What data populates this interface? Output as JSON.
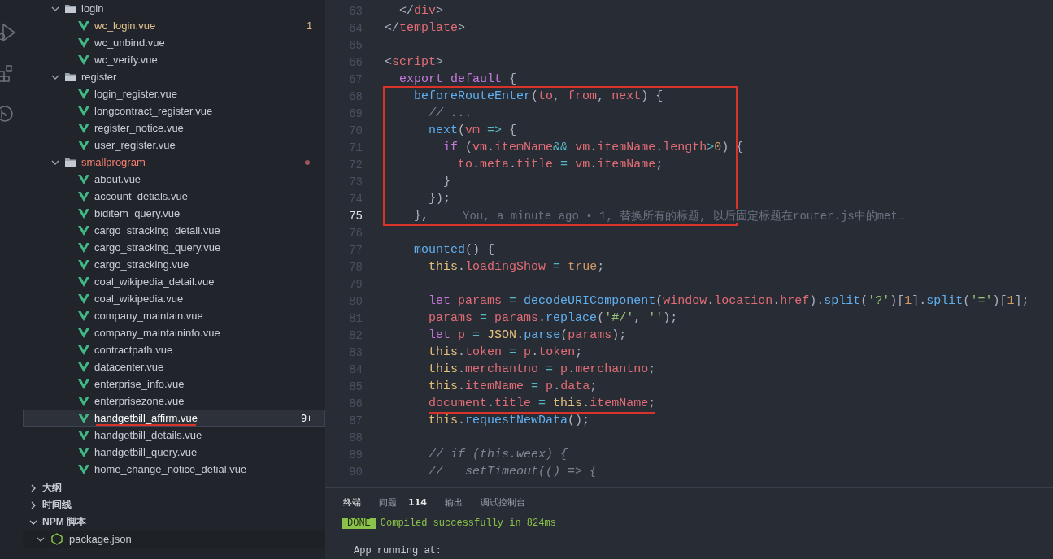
{
  "explorer": {
    "items": [
      {
        "label": "login",
        "kind": "folder",
        "expanded": true,
        "selected": false,
        "modified": false,
        "errors": false,
        "children": [
          {
            "label": "wc_login.vue",
            "kind": "file",
            "selected": false,
            "modified": true,
            "errors": false,
            "badge": "1"
          },
          {
            "label": "wc_unbind.vue",
            "kind": "file",
            "selected": false,
            "modified": false,
            "errors": false
          },
          {
            "label": "wc_verify.vue",
            "kind": "file",
            "selected": false,
            "modified": false,
            "errors": false
          }
        ]
      },
      {
        "label": "register",
        "kind": "folder",
        "expanded": true,
        "selected": false,
        "modified": false,
        "errors": false,
        "children": [
          {
            "label": "login_register.vue",
            "kind": "file",
            "selected": false,
            "modified": false,
            "errors": false
          },
          {
            "label": "longcontract_register.vue",
            "kind": "file",
            "selected": false,
            "modified": false,
            "errors": false
          },
          {
            "label": "register_notice.vue",
            "kind": "file",
            "selected": false,
            "modified": false,
            "errors": false
          },
          {
            "label": "user_register.vue",
            "kind": "file",
            "selected": false,
            "modified": false,
            "errors": false
          }
        ]
      },
      {
        "label": "smallprogram",
        "kind": "folder",
        "expanded": true,
        "selected": false,
        "modified": false,
        "errors": true,
        "children": [
          {
            "label": "about.vue",
            "kind": "file",
            "selected": false,
            "modified": false,
            "errors": false
          },
          {
            "label": "account_detials.vue",
            "kind": "file",
            "selected": false,
            "modified": false,
            "errors": false
          },
          {
            "label": "biditem_query.vue",
            "kind": "file",
            "selected": false,
            "modified": false,
            "errors": false
          },
          {
            "label": "cargo_stracking_detail.vue",
            "kind": "file",
            "selected": false,
            "modified": false,
            "errors": false
          },
          {
            "label": "cargo_stracking_query.vue",
            "kind": "file",
            "selected": false,
            "modified": false,
            "errors": false
          },
          {
            "label": "cargo_stracking.vue",
            "kind": "file",
            "selected": false,
            "modified": false,
            "errors": false
          },
          {
            "label": "coal_wikipedia_detail.vue",
            "kind": "file",
            "selected": false,
            "modified": false,
            "errors": false
          },
          {
            "label": "coal_wikipedia.vue",
            "kind": "file",
            "selected": false,
            "modified": false,
            "errors": false
          },
          {
            "label": "company_maintain.vue",
            "kind": "file",
            "selected": false,
            "modified": false,
            "errors": false
          },
          {
            "label": "company_maintaininfo.vue",
            "kind": "file",
            "selected": false,
            "modified": false,
            "errors": false
          },
          {
            "label": "contractpath.vue",
            "kind": "file",
            "selected": false,
            "modified": false,
            "errors": false
          },
          {
            "label": "datacenter.vue",
            "kind": "file",
            "selected": false,
            "modified": false,
            "errors": false
          },
          {
            "label": "enterprise_info.vue",
            "kind": "file",
            "selected": false,
            "modified": false,
            "errors": false
          },
          {
            "label": "enterprisezone.vue",
            "kind": "file",
            "selected": false,
            "modified": false,
            "errors": false
          },
          {
            "label": "handgetbill_affirm.vue",
            "kind": "file",
            "selected": true,
            "modified": false,
            "errors": false,
            "badge": "9+"
          },
          {
            "label": "handgetbill_details.vue",
            "kind": "file",
            "selected": false,
            "modified": false,
            "errors": false
          },
          {
            "label": "handgetbill_query.vue",
            "kind": "file",
            "selected": false,
            "modified": false,
            "errors": false
          },
          {
            "label": "home_change_notice_detial.vue",
            "kind": "file",
            "selected": false,
            "modified": false,
            "errors": false
          }
        ]
      }
    ]
  },
  "sections": [
    {
      "label": "大纲",
      "expanded": false
    },
    {
      "label": "时间线",
      "expanded": false
    },
    {
      "label": "NPM 脚本",
      "expanded": true,
      "children": [
        {
          "label": "package.json",
          "expanded": true
        }
      ]
    }
  ],
  "editor": {
    "blocks": [
      {
        "framed": false,
        "underlined": false,
        "lines": [
          {
            "number": "63",
            "text": "  </div>",
            "current": false
          },
          {
            "number": "64",
            "text": "</template>",
            "current": false
          },
          {
            "number": "65",
            "current": false
          },
          {
            "number": "66",
            "text": "<script>",
            "current": false
          },
          {
            "number": "67",
            "text": "  export default {",
            "current": false
          }
        ]
      },
      {
        "framed": true,
        "underlined": false,
        "lines": [
          {
            "number": "68",
            "text": "    beforeRouteEnter(to, from, next) {",
            "current": false
          },
          {
            "number": "69",
            "text": "      // ...",
            "current": false
          },
          {
            "number": "70",
            "text": "      next(vm => {",
            "current": false
          },
          {
            "number": "71",
            "text": "        if (vm.itemName&& vm.itemName.length>0) {",
            "current": false
          },
          {
            "number": "72",
            "text": "          to.meta.title = vm.itemName;",
            "current": false
          },
          {
            "number": "73",
            "text": "        }",
            "current": false
          },
          {
            "number": "74",
            "text": "      });",
            "current": false
          },
          {
            "number": "75",
            "text": "    },",
            "current": true,
            "blame": "You, a minute ago • 1, 替换所有的标题, 以后固定标题在router.js中的met…"
          }
        ]
      },
      {
        "framed": false,
        "underlined": false,
        "lines": [
          {
            "number": "76",
            "current": false
          },
          {
            "number": "77",
            "text": "    mounted() {",
            "current": false
          },
          {
            "number": "78",
            "text": "      this.loadingShow = true;",
            "current": false
          },
          {
            "number": "79",
            "current": false
          },
          {
            "number": "80",
            "text": "      let params = decodeURIComponent(window.location.href).split('?')[1].split('=')[1];",
            "current": false
          },
          {
            "number": "81",
            "text": "      params = params.replace('#/', '');",
            "current": false
          },
          {
            "number": "82",
            "text": "      let p = JSON.parse(params);",
            "current": false
          },
          {
            "number": "83",
            "text": "      this.token = p.token;",
            "current": false
          },
          {
            "number": "84",
            "text": "      this.merchantno = p.merchantno;",
            "current": false
          },
          {
            "number": "85",
            "text": "      this.itemName = p.data;",
            "current": false
          }
        ]
      },
      {
        "framed": false,
        "underlined": true,
        "lines": [
          {
            "number": "86",
            "text": "      document.title = this.itemName;",
            "current": false
          }
        ]
      },
      {
        "framed": false,
        "underlined": false,
        "lines": [
          {
            "number": "87",
            "text": "      this.requestNewData();",
            "current": false
          },
          {
            "number": "88",
            "current": false
          },
          {
            "number": "89",
            "text": "      // if (this.weex) {",
            "current": false
          },
          {
            "number": "90",
            "text": "      //   setTimeout(() => {",
            "current": false
          }
        ]
      }
    ]
  },
  "panel": {
    "tabs": [
      {
        "label": "终端",
        "selected": true
      },
      {
        "label": "问题",
        "selected": false,
        "count": "114"
      },
      {
        "label": "输出",
        "selected": false
      },
      {
        "label": "调试控制台",
        "selected": false
      }
    ],
    "terminal": [
      {
        "kind": "status",
        "badge": "DONE",
        "text": "Compiled successfully in 824ms"
      },
      {
        "kind": "plain",
        "text": "App running at:"
      }
    ]
  }
}
